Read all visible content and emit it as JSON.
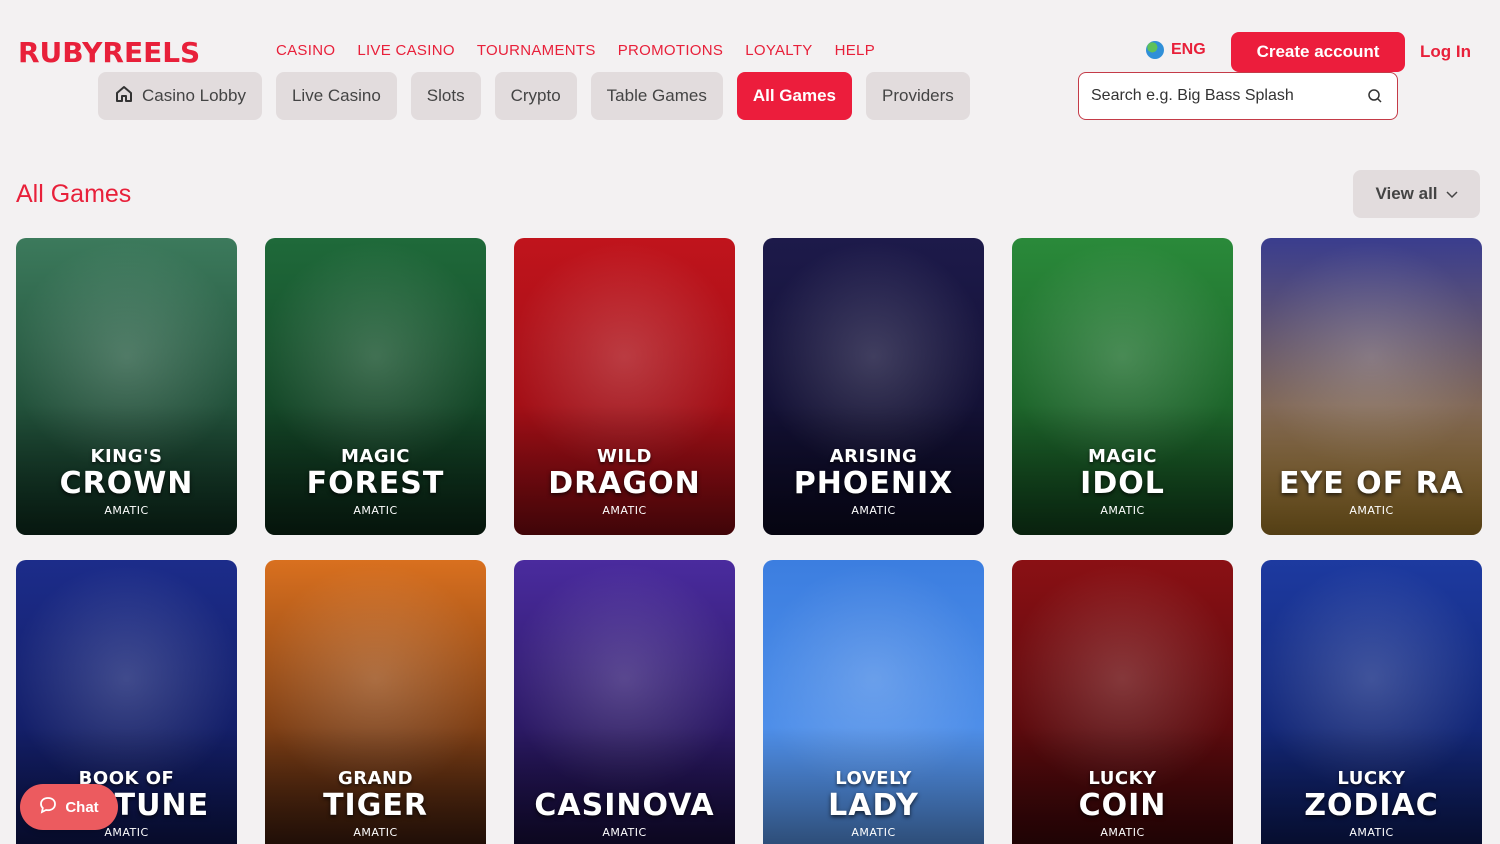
{
  "brand": {
    "logo": "RUBYREELS",
    "accent": "#ec1d3c"
  },
  "nav": [
    "CASINO",
    "LIVE CASINO",
    "TOURNAMENTS",
    "PROMOTIONS",
    "LOYALTY",
    "HELP"
  ],
  "header": {
    "language": "ENG",
    "create_account": "Create account",
    "login": "Log In"
  },
  "tabs": [
    {
      "label": "Casino Lobby",
      "icon": "home-icon",
      "active": false
    },
    {
      "label": "Live Casino",
      "active": false
    },
    {
      "label": "Slots",
      "active": false
    },
    {
      "label": "Crypto",
      "active": false
    },
    {
      "label": "Table Games",
      "active": false
    },
    {
      "label": "All Games",
      "active": true
    },
    {
      "label": "Providers",
      "active": false
    }
  ],
  "search": {
    "placeholder": "Search e.g. Big Bass Splash"
  },
  "section": {
    "title": "All Games",
    "view_all": "View all"
  },
  "games": [
    {
      "line1": "KING'S",
      "line2": "CROWN",
      "provider": "AMATIC",
      "c1": "#3c7a5c",
      "c2": "#0f3322"
    },
    {
      "line1": "MAGIC",
      "line2": "FOREST",
      "provider": "AMATIC",
      "c1": "#1f6a3a",
      "c2": "#0c2d1a"
    },
    {
      "line1": "WILD",
      "line2": "DRAGON",
      "provider": "AMATIC",
      "c1": "#c0141c",
      "c2": "#8d0b12"
    },
    {
      "line1": "ARISING",
      "line2": "PHOENIX",
      "provider": "AMATIC",
      "c1": "#1d1a4a",
      "c2": "#0c0a26"
    },
    {
      "line1": "MAGIC",
      "line2": "IDOL",
      "provider": "AMATIC",
      "c1": "#2a8a3a",
      "c2": "#134a1f"
    },
    {
      "line1": "",
      "line2": "EYE OF RA",
      "provider": "AMATIC",
      "c1": "#3a3d8e",
      "c2": "#b88a2e"
    },
    {
      "line1": "BOOK OF",
      "line2": "FORTUNE",
      "provider": "AMATIC",
      "c1": "#1c2c8a",
      "c2": "#0d1550"
    },
    {
      "line1": "GRAND",
      "line2": "TIGER",
      "provider": "AMATIC",
      "c1": "#d9701f",
      "c2": "#3a1a0d"
    },
    {
      "line1": "",
      "line2": "CASINOVA",
      "provider": "AMATIC",
      "c1": "#4a2b9e",
      "c2": "#150c3a"
    },
    {
      "line1": "LOVELY",
      "line2": "LADY",
      "provider": "AMATIC",
      "c1": "#3c7ee0",
      "c2": "#5c9bf0"
    },
    {
      "line1": "LUCKY",
      "line2": "COIN",
      "provider": "AMATIC",
      "c1": "#8a1014",
      "c2": "#3a0608"
    },
    {
      "line1": "LUCKY",
      "line2": "ZODIAC",
      "provider": "AMATIC",
      "c1": "#1d3aa0",
      "c2": "#0c1a5a"
    }
  ],
  "chat": {
    "label": "Chat"
  }
}
